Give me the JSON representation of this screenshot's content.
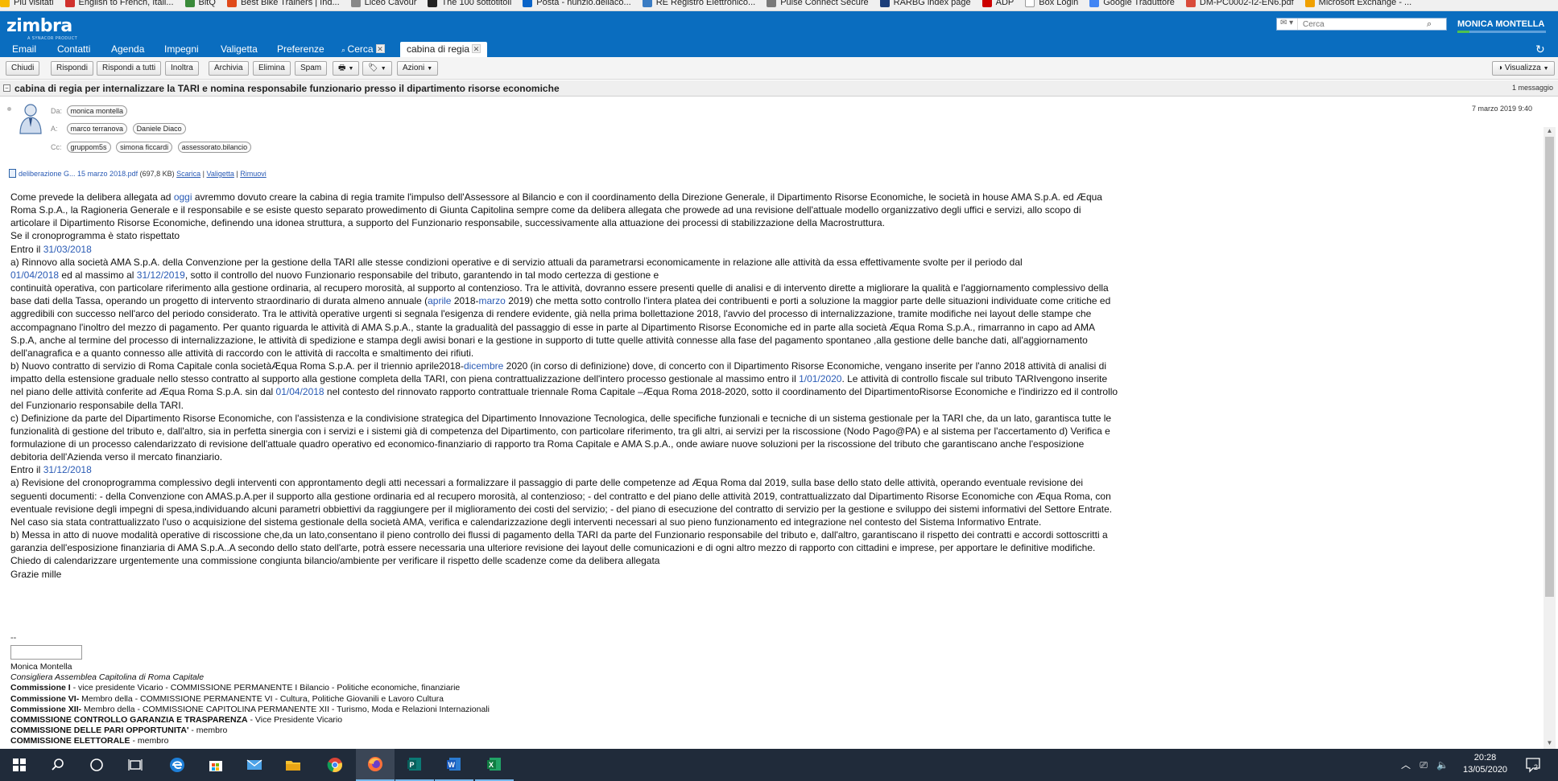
{
  "bookmarks": [
    {
      "label": "Più visitati",
      "color": "#f7b800"
    },
    {
      "label": "English to French, Itali...",
      "color": "#d0312d"
    },
    {
      "label": "BitQ",
      "color": "#3a8a3a"
    },
    {
      "label": "Best Bike Trainers | Ind...",
      "color": "#e04a1b"
    },
    {
      "label": "Liceo Cavour",
      "color": "#888888"
    },
    {
      "label": "The 100 sottotitoli",
      "color": "#222222"
    },
    {
      "label": "Posta - nunzio.dellaco...",
      "color": "#0a64c8"
    },
    {
      "label": "RE Registro Elettronico...",
      "color": "#3a7cc3"
    },
    {
      "label": "Pulse Connect Secure",
      "color": "#7a7a7a"
    },
    {
      "label": "RARBG index page",
      "color": "#1a3d7a"
    },
    {
      "label": "ADP",
      "color": "#cc0000"
    },
    {
      "label": "Box Login",
      "color": "#ffffff"
    },
    {
      "label": "Google Traduttore",
      "color": "#4285f4"
    },
    {
      "label": "DM-PC0002-I2-EN6.pdf",
      "color": "#d94b3b"
    },
    {
      "label": "Microsoft Exchange - ...",
      "color": "#f0a000"
    }
  ],
  "header": {
    "logo": "zimbra",
    "logo_tag": "A SYNACOR PRODUCT",
    "search_placeholder": "Cerca",
    "username": "MONICA MONTELLA"
  },
  "tabs": {
    "email": "Email",
    "contatti": "Contatti",
    "agenda": "Agenda",
    "impegni": "Impegni",
    "valigetta": "Valigetta",
    "preferenze": "Preferenze",
    "cerca": "Cerca",
    "active": "cabina di regia"
  },
  "toolbar": {
    "chiudi": "Chiudi",
    "rispondi": "Rispondi",
    "rispondi_tutti": "Rispondi a tutti",
    "inoltra": "Inoltra",
    "archivia": "Archivia",
    "elimina": "Elimina",
    "spam": "Spam",
    "azioni": "Azioni",
    "visualizza": "Visualizza"
  },
  "message": {
    "subject": "cabina di regia per internalizzare la TARI e nomina responsabile funzionario presso il dipartimento risorse economiche",
    "count": "1 messaggio",
    "date": "7 marzo 2019 9:40",
    "from_label": "Da:",
    "to_label": "A:",
    "cc_label": "Cc:",
    "from": [
      "monica montella"
    ],
    "to": [
      "marco terranova",
      "Daniele Diaco"
    ],
    "cc": [
      "gruppom5s",
      "simona ficcardi",
      "assessorato.bilancio"
    ],
    "attachment": {
      "name": "deliberazione G... 15 marzo 2018.pdf",
      "size": "(697,8 KB)",
      "scarica": "Scarica",
      "valigetta": "Valigetta",
      "rimuovi": "Rimuovi"
    }
  },
  "body": {
    "p1a": "Come prevede la delibera allegata ad ",
    "p1d": "oggi",
    "p1b": " avremmo dovuto creare la cabina di regia tramite l'impulso dell'Assessore al Bilancio e con il coordinamento  della Direzione Generale, il Dipartimento Risorse Economiche, le società in house AMA S.p.A. ed Æqua Roma S.p.A., la Ragioneria Generale e il responsabile e se esiste questo separato prowedimento di Giunta Capitolina sempre come da delibera allegata che prowede ad una revisione dell'attuale modello organizzativo degli uffici e servizi, allo scopo di articolare il Dipartimento Risorse Economiche, definendo una idonea struttura, a supporto del Funzionario responsabile, successivamente alla attuazione dei processi di stabilizzazione della Macrostruttura.",
    "p2": "Se il cronoprogramma è stato rispettato",
    "p3a": "Entro il ",
    "p3d": "31/03/2018",
    "p4a": "a) Rinnovo alla società AMA S.p.A. della Convenzione per la gestione della TARI alle stesse condizioni operative e di servizio attuali da parametrarsi economicamente in relazione alle attività da essa effettivamente svolte per il periodo dal",
    "p5d1": "01/04/2018",
    "p5a": " ed al massimo al ",
    "p5d2": "31/12/2019",
    "p5b": ", sotto il controllo del nuovo Funzionario responsabile del tributo, garantendo in tal modo certezza di gestione e",
    "p6a": "continuità operativa, con particolare riferimento alla gestione ordinaria, al recupero morosità, al supporto al contenzioso. Tra le attività, dovranno essere presenti quelle di analisi e di intervento dirette a migliorare la qualità e l'aggiornamento complessivo della base dati della Tassa, operando un progetto di intervento straordinario di durata almeno annuale (",
    "p6d1": "aprile",
    "p6b": " 2018-",
    "p6d2": "marzo",
    "p6c": " 2019) che metta sotto controllo l'intera platea dei contribuenti e porti a soluzione la maggior parte delle situazioni individuate come critiche ed aggredibili con successo nell'arco del periodo considerato. Tra le attività operative urgenti si segnala l'esigenza di rendere evidente, già nella prima bollettazione 2018, l'avvio del processo di internalizzazione, tramite modifiche nei layout delle stampe che accompagnano l'inoltro del  mezzo  di  pagamento. Per   quanto  riguarda  le attività di AMA S.p.A.,  stante la gradualità del passaggio di esse in parte al Dipartimento Risorse Economiche ed in  parte alla società  Æqua  Roma  S.p.A., rimarranno in capo ad AMA S.p.A, anche al termine del processo di internalizzazione, le  attività  di  spedizione e stampa degli awisi  bonari e la  gestione in  supporto di tutte quelle attività connesse alla fase  del   pagamento spontaneo ,alla gestione  delle banche dati, all'aggiornamento dell'anagrafica e a quanto connesso alle attività di raccordo con le attività di raccolta e smaltimento dei rifiuti.",
    "p7a": "b) Nuovo contratto di servizio di Roma Capitale conla societàÆqua Roma S.p.A. per il triennio aprile2018-",
    "p7d1": "dicembre",
    "p7b": " 2020 (in corso di definizione) dove, di concerto con il Dipartimento Risorse Economiche, vengano inserite per l'anno 2018 attività di analisi di impatto della estensione graduale nello stesso contratto al supporto alla gestione completa della TARI, con piena contrattualizzazione dell'intero processo gestionale al massimo entro il ",
    "p7d2": "1/01/2020",
    "p7c": ". Le attività di controllo fiscale sul tributo TARIvengono inserite nel piano delle attività conferite ad Æqua Roma S.p.A. sin dal ",
    "p7d3": "01/04/2018",
    "p7e": " nel contesto del rinnovato rapporto contrattuale triennale Roma Capitale –Æqua Roma 2018-2020, sotto il coordinamento del DipartimentoRisorse Economiche e l'indirizzo ed il controllo del Funzionario responsabile della TARI.",
    "p8": "c) Definizione da parte del Dipartimento Risorse Economiche, con l'assistenza e la condivisione strategica del Dipartimento Innovazione Tecnologica, delle specifiche funzionali e tecniche di un sistema gestionale per la TARI che, da un lato, garantisca tutte le funzionalità di gestione del tributo e, dall'altro, sia in perfetta sinergia con i servizi e i sistemi già di competenza del Dipartimento, con particolare riferimento, tra gli altri, ai servizi per la riscossione (Nodo Pago@PA) e al sistema per l'accertamento d) Verifica e formulazione di un processo calendarizzato di revisione dell'attuale quadro operativo ed economico-finanziario di rapporto tra Roma Capitale e AMA S.p.A., onde awiare nuove soluzioni per la riscossione del tributo che garantiscano anche l'esposizione debitoria dell'Azienda verso il mercato finanziario.",
    "p9a": "Entro il ",
    "p9d": "31/12/2018",
    "p10": "a) Revisione del cronoprogramma complessivo degli interventi con approntamento degli atti necessari a formalizzare il passaggio di parte delle competenze ad Æqua Roma dal 2019, sulla base dello stato delle attività, operando eventuale revisione dei seguenti documenti: - della Convenzione con AMAS.p.A.per il supporto alla gestione ordinaria ed al recupero morosità, al contenzioso; - del contratto e del piano delle attività 2019, contrattualizzato dal Dipartimento Risorse Economiche con Æqua Roma, con eventuale revisione degli impegni di spesa,individuando  alcuni parametri obbiettivi da raggiungere per il miglioramento dei costi del servizio; - del piano di esecuzione del contratto di servizio per la gestione e sviluppo dei sistemi informativi del Settore Entrate. Nel caso sia stata contrattualizzato l'uso o acquisizione del sistema gestionale della società AMA, verifica e calendarizzazione degli interventi necessari al suo pieno funzionamento ed integrazione nel contesto del Sistema Informativo Entrate.",
    "p11": "b) Messa in atto di nuove modalità operative di riscossione che,da un lato,consentano il pieno controllo dei flussi di pagamento della TARI da parte del Funzionario responsabile del tributo e, dall'altro, garantiscano il rispetto dei contratti e accordi sottoscritti a garanzia dell'esposizione finanziaria di AMA S.p.A..A secondo dello stato dell'arte, potrà essere necessaria una ulteriore revisione dei layout delle comunicazioni e di ogni altro mezzo di rapporto con cittadini e imprese, per apportare le definitive modifiche.",
    "p12": "Chiedo di calendarizzare urgentemente una commissione congiunta bilancio/ambiente per verificare il rispetto delle scadenze come da delibera allegata",
    "p13": "Grazie mille"
  },
  "signature": {
    "sep": "--",
    "name": "Monica Montella",
    "role": "Consigliera Assemblea Capitolina di Roma Capitale",
    "c1b": "Commissione I",
    "c1": " - vice presidente Vicario - COMMISSIONE PERMANENTE I Bilancio - Politiche economiche, finanziarie",
    "c2b": "Commissione VI-",
    "c2": " Membro della - COMMISSIONE PERMANENTE VI - Cultura, Politiche Giovanili e Lavoro Cultura",
    "c3b": "Commissione XII-",
    "c3": " Membro della - COMMISSIONE CAPITOLINA PERMANENTE XII - Turismo, Moda e Relazioni Internazionali",
    "c4b": "COMMISSIONE CONTROLLO GARANZIA E TRASPARENZA",
    "c4": " - Vice Presidente Vicario",
    "c5b": "COMMISSIONE DELLE PARI OPPORTUNITA'",
    "c5": " - membro",
    "c6b": "COMMISSIONE ELETTORALE",
    "c6": " - membro"
  },
  "taskbar": {
    "time": "20:28",
    "date": "13/05/2020",
    "notifications": "2"
  }
}
